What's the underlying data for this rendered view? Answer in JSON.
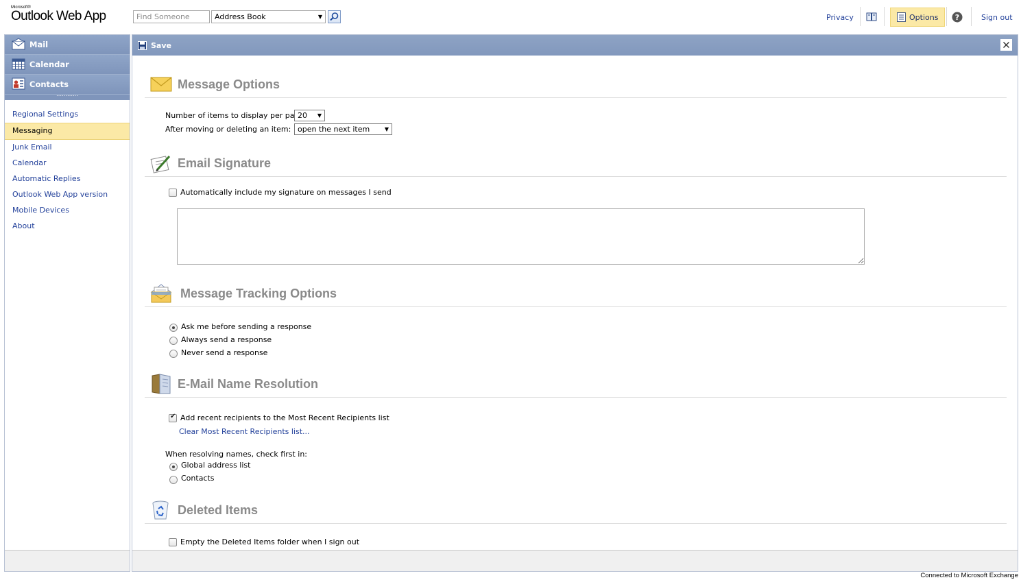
{
  "header": {
    "brand_small": "Microsoft®",
    "brand": "Outlook Web App",
    "find_placeholder": "Find Someone",
    "address_book": "Address Book",
    "privacy": "Privacy",
    "options": "Options",
    "sign_out": "Sign out"
  },
  "sidebar": {
    "nav": [
      {
        "label": "Mail",
        "icon": "mail-icon"
      },
      {
        "label": "Calendar",
        "icon": "calendar-icon"
      },
      {
        "label": "Contacts",
        "icon": "contacts-icon"
      }
    ],
    "grip": "⋯⋯⋯⋯",
    "items": [
      {
        "label": "Regional Settings"
      },
      {
        "label": "Messaging",
        "selected": true
      },
      {
        "label": "Junk Email"
      },
      {
        "label": "Calendar"
      },
      {
        "label": "Automatic Replies"
      },
      {
        "label": "Outlook Web App version"
      },
      {
        "label": "Mobile Devices"
      },
      {
        "label": "About"
      }
    ]
  },
  "toolbar": {
    "save": "Save"
  },
  "message_options": {
    "title": "Message Options",
    "items_per_page_label": "Number of items to display per page:",
    "items_per_page_value": "20",
    "after_move_label": "After moving or deleting an item:",
    "after_move_value": "open the next item"
  },
  "email_signature": {
    "title": "Email Signature",
    "auto_include_label": "Automatically include my signature on messages I send",
    "auto_include_checked": false,
    "signature_text": ""
  },
  "tracking": {
    "title": "Message Tracking Options",
    "options": [
      {
        "label": "Ask me before sending a response",
        "checked": true
      },
      {
        "label": "Always send a response",
        "checked": false
      },
      {
        "label": "Never send a response",
        "checked": false
      }
    ]
  },
  "name_resolution": {
    "title": "E-Mail Name Resolution",
    "recent_label": "Add recent recipients to the Most Recent Recipients list",
    "recent_checked": true,
    "clear_link": "Clear Most Recent Recipients list...",
    "resolve_label": "When resolving names, check first in:",
    "resolve_options": [
      {
        "label": "Global address list",
        "checked": true
      },
      {
        "label": "Contacts",
        "checked": false
      }
    ]
  },
  "deleted_items": {
    "title": "Deleted Items",
    "empty_label": "Empty the Deleted Items folder when I sign out",
    "empty_checked": false
  },
  "status": "Connected to Microsoft Exchange",
  "colors": {
    "nav_blue": "#8298bd",
    "selection_yellow": "#fbe9a6",
    "link_blue": "#22409a"
  }
}
